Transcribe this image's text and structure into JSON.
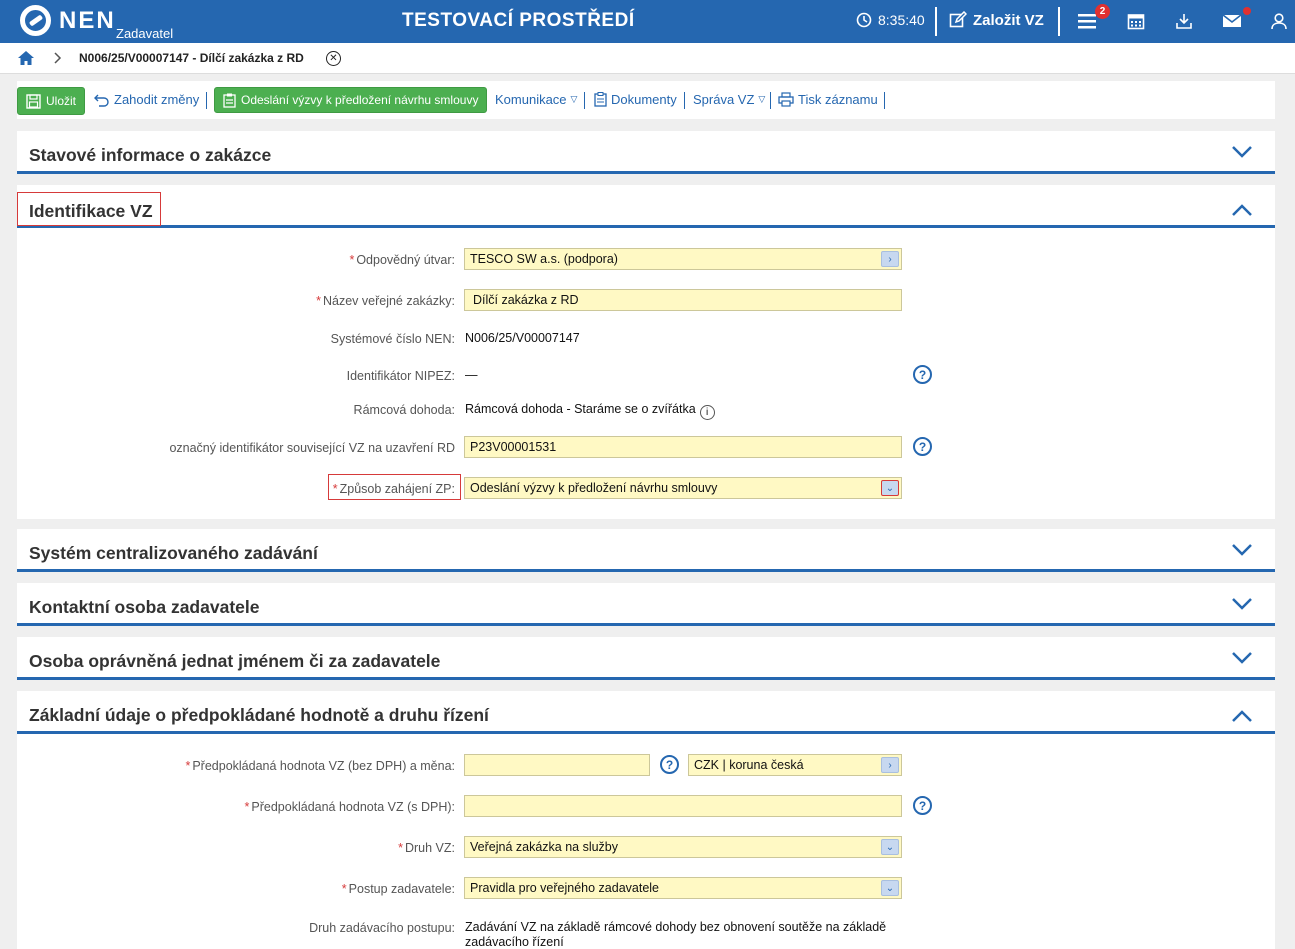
{
  "header": {
    "logo_text": "NEN",
    "logo_sub": "Zadavatel",
    "environment_title": "TESTOVACÍ PROSTŘEDÍ",
    "time": "8:35:40",
    "create_label": "Založit VZ",
    "menu_badge": "2"
  },
  "breadcrumb": {
    "current": "N006/25/V00007147 - Dílčí zakázka z RD"
  },
  "toolbar": {
    "save_label": "Uložit",
    "discard_label": "Zahodit změny",
    "send_label": "Odeslání výzvy k předložení návrhu smlouvy",
    "communication_label": "Komunikace",
    "documents_label": "Dokumenty",
    "manage_label": "Správa VZ",
    "print_label": "Tisk záznamu"
  },
  "sections": {
    "status": "Stavové informace o zakázce",
    "identification": "Identifikace VZ",
    "centralized": "Systém centralizovaného zadávání",
    "contact": "Kontaktní osoba zadavatele",
    "authorized": "Osoba oprávněná jednat jménem či za zadavatele",
    "basic": "Základní údaje o předpokládané hodnotě a druhu řízení"
  },
  "identification": {
    "unit_label": "Odpovědný útvar:",
    "unit_value": "TESCO SW a.s. (podpora)",
    "name_label": "Název veřejné zakázky:",
    "name_value": "Dílčí zakázka z RD",
    "sysnum_label": "Systémové číslo NEN:",
    "sysnum_value": "N006/25/V00007147",
    "nipez_label": "Identifikátor NIPEZ:",
    "nipez_value": "—",
    "framework_label": "Rámcová dohoda:",
    "framework_value": "Rámcová dohoda - Staráme se o zvířátka",
    "related_label": "označný identifikátor související VZ na uzavření RD:",
    "related_value": "P23V00001531",
    "start_label": "Způsob zahájení ZP:",
    "start_value": "Odeslání výzvy k předložení návrhu smlouvy"
  },
  "basic": {
    "value_label": "Předpokládaná hodnota VZ (bez DPH) a měna:",
    "value_value": "",
    "currency_value": "CZK | koruna česká",
    "value_dph_label": "Předpokládaná hodnota VZ (s DPH):",
    "value_dph_value": "",
    "type_label": "Druh VZ:",
    "type_value": "Veřejná zakázka na služby",
    "procedure_label": "Postup zadavatele:",
    "procedure_value": "Pravidla pro veřejného zadavatele",
    "kind_label": "Druh zadávacího postupu:",
    "kind_value_line1": "Zadávání VZ na základě rámcové dohody bez obnovení soutěže na základě",
    "kind_value_line2": "zadávacího řízení"
  },
  "colors": {
    "primary": "#2567b0",
    "green": "#4caf50",
    "field_yellow": "#fff9c4",
    "highlight_red": "#d63a3a"
  }
}
